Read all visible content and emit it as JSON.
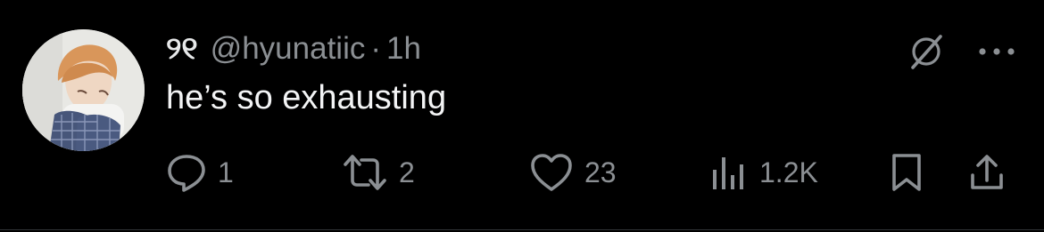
{
  "post": {
    "display_name": "୨୧",
    "handle": "@hyunatiic",
    "separator": "·",
    "timestamp": "1h",
    "text": "he’s so exhausting"
  },
  "actions": {
    "reply_count": "1",
    "repost_count": "2",
    "like_count": "23",
    "view_count": "1.2K"
  },
  "icons": {
    "reply": "reply-bubble-icon",
    "repost": "repost-arrows-icon",
    "like": "heart-icon",
    "views": "views-bars-icon",
    "bookmark": "bookmark-icon",
    "share": "share-upload-icon",
    "grok": "grok-slash-icon",
    "more": "more-dots-icon"
  },
  "colors": {
    "background": "#000000",
    "text_primary": "#e7e9ea",
    "text_secondary": "#8b8f93"
  }
}
